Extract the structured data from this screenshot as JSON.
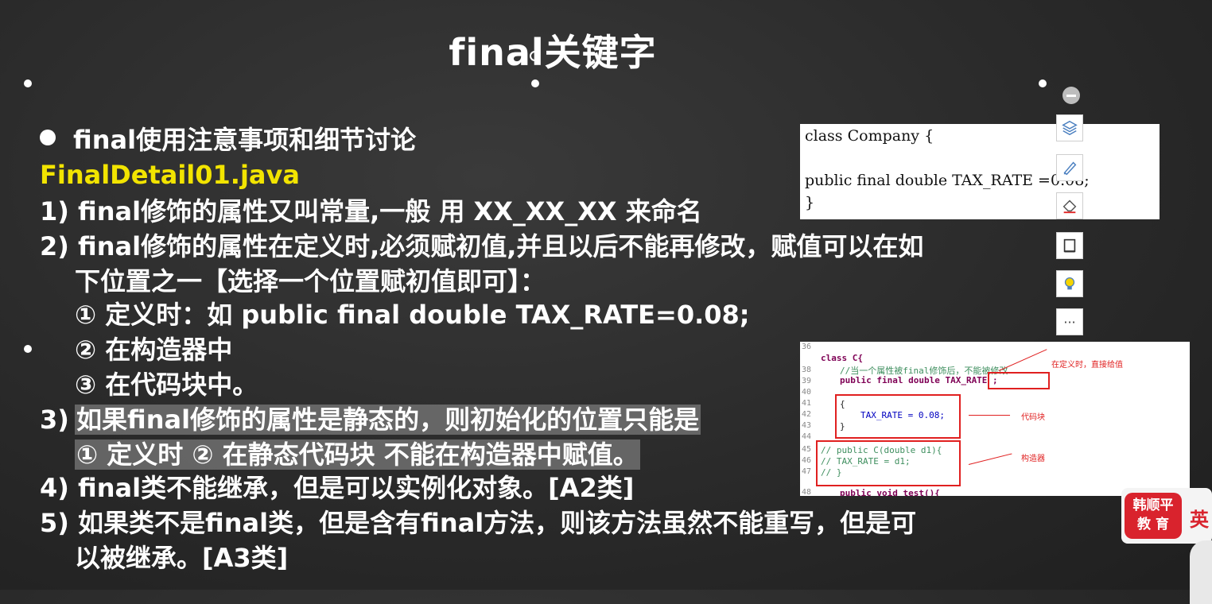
{
  "slide": {
    "title": "final关键字",
    "heading": "final使用注意事项和细节讨论",
    "filename": "FinalDetail01.java",
    "lines": [
      "1) final修饰的属性又叫常量,一般 用 XX_XX_XX 来命名",
      "2) final修饰的属性在定义时,必须赋初值,并且以后不能再修改，赋值可以在如",
      "下位置之一【选择一个位置赋初值即可】：",
      "① 定义时：如 public final double TAX_RATE=0.08;",
      "② 在构造器中",
      "③ 在代码块中。",
      "3)",
      "如果final修饰的属性是静态的，则初始化的位置只能是",
      "① 定义时  ② 在静态代码块 不能在构造器中赋值。",
      "4) final类不能继承，但是可以实例化对象。[A2类]",
      "5) 如果类不是final类，但是含有final方法，则该方法虽然不能重写，但是可",
      "以被继承。[A3类]"
    ]
  },
  "code_snippet": {
    "line1": "class Company {",
    "line2": "public final double TAX_RATE =0.08;",
    "line3": "}"
  },
  "ide": {
    "line_numbers": [
      "36",
      "38",
      "39",
      "40",
      "41",
      "42",
      "43",
      "44",
      "45",
      "46",
      "47",
      "48"
    ],
    "lines": [
      "class C{",
      "//当一个属性被final修饰后，不能被修改",
      "public final double TAX_RATE ;",
      "",
      "{",
      "TAX_RATE = 0.08;",
      "}",
      "",
      "//  public C(double d1){",
      "//      TAX_RATE = d1;",
      "//  }",
      "public void test(){"
    ],
    "annotations": {
      "define": "在定义时，直接给值",
      "block": "代码块",
      "ctor": "构造器"
    }
  },
  "logo": {
    "line1": "韩顺平",
    "line2": "教 育",
    "lang": "英"
  },
  "toolbar": {
    "icons": [
      "minus-icon",
      "layers-icon",
      "pen-icon",
      "eraser-icon",
      "frame-icon",
      "lightbulb-icon",
      "more-icon"
    ],
    "more_label": "···"
  }
}
